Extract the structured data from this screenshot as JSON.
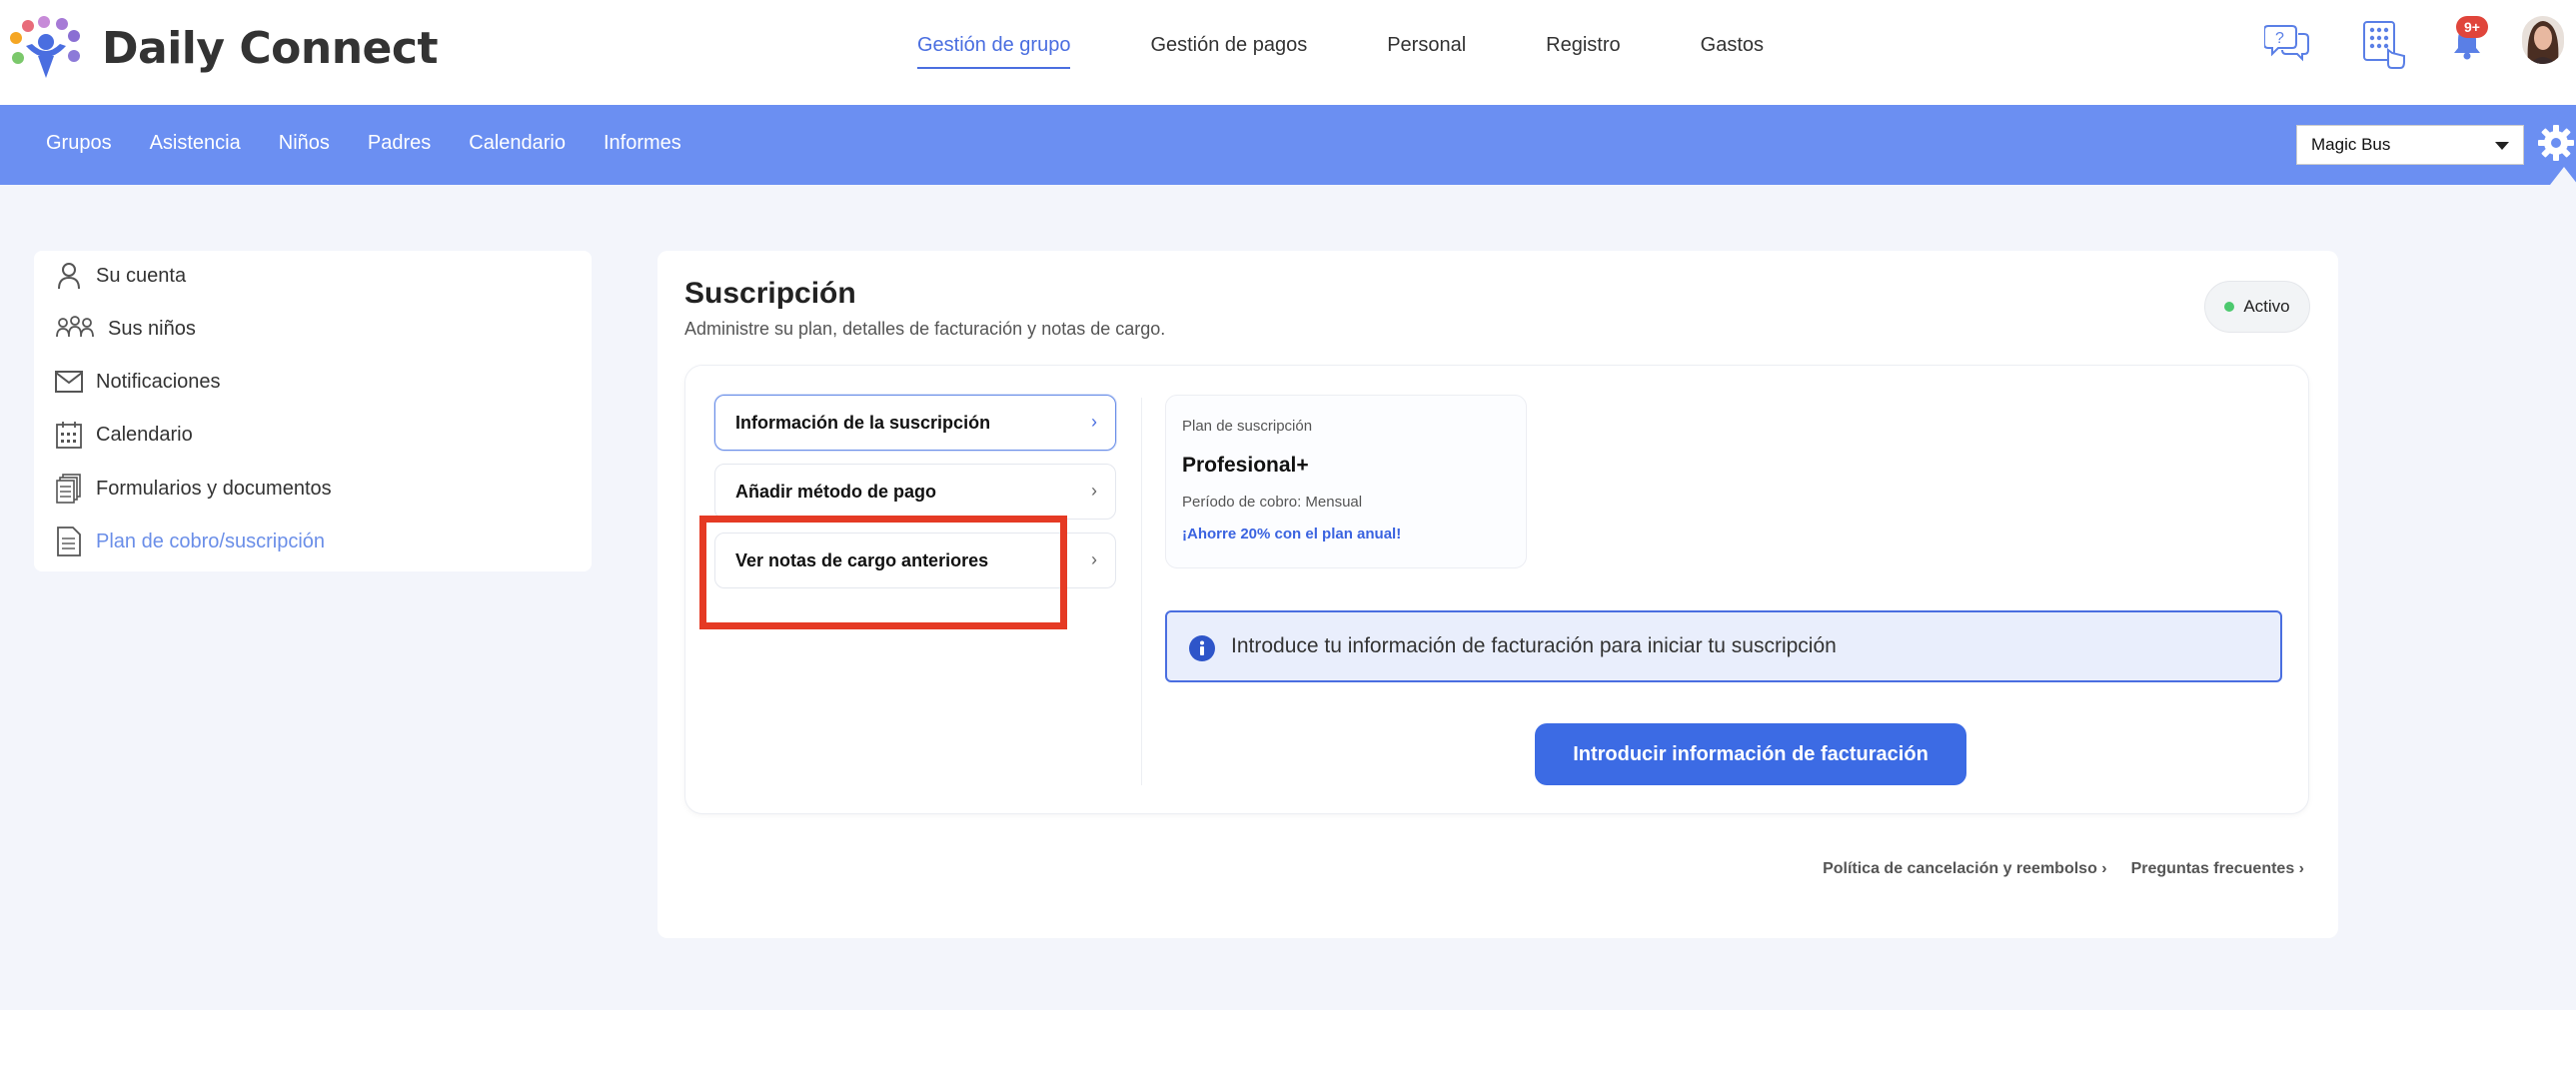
{
  "app": {
    "name": "Daily Connect"
  },
  "top_nav": [
    {
      "label": "Gestión de grupo",
      "active": true
    },
    {
      "label": "Gestión de pagos",
      "active": false
    },
    {
      "label": "Personal",
      "active": false
    },
    {
      "label": "Registro",
      "active": false
    },
    {
      "label": "Gastos",
      "active": false
    }
  ],
  "top_icons": {
    "help": "chat-help-icon",
    "keypad": "keypad-icon",
    "notifications": "bell-icon",
    "notification_badge": "9+"
  },
  "sub_nav": [
    {
      "label": "Grupos"
    },
    {
      "label": "Asistencia"
    },
    {
      "label": "Niños"
    },
    {
      "label": "Padres"
    },
    {
      "label": "Calendario"
    },
    {
      "label": "Informes"
    }
  ],
  "center_select": {
    "value": "Magic Bus"
  },
  "sidebar": {
    "items": [
      {
        "label": "Su cuenta",
        "icon": "user-icon",
        "active": false
      },
      {
        "label": "Sus niños",
        "icon": "children-icon",
        "active": false
      },
      {
        "label": "Notificaciones",
        "icon": "mail-icon",
        "active": false
      },
      {
        "label": "Calendario",
        "icon": "calendar-icon",
        "active": false
      },
      {
        "label": "Formularios y documentos",
        "icon": "documents-icon",
        "active": false
      },
      {
        "label": "Plan de cobro/suscripción",
        "icon": "document-icon",
        "active": true
      }
    ]
  },
  "main": {
    "title": "Suscripción",
    "subtitle": "Administre su plan, detalles de facturación y notas de cargo.",
    "status": "Activo",
    "menu": [
      {
        "label": "Información de la suscripción",
        "active": true
      },
      {
        "label": "Añadir método de pago",
        "active": false
      },
      {
        "label": "Ver notas de cargo anteriores",
        "active": false
      }
    ],
    "plan": {
      "label": "Plan de suscripción",
      "name": "Profesional+",
      "period": "Período de cobro:  Mensual",
      "savings": "¡Ahorre 20% con el plan anual!"
    },
    "info_message": "Introduce tu información de facturación para iniciar tu suscripción",
    "cta_label": "Introducir información de facturación",
    "footer_links": [
      {
        "label": "Política de cancelación y reembolso ›"
      },
      {
        "label": "Preguntas frecuentes ›"
      }
    ]
  },
  "colors": {
    "accent": "#4a6ee0",
    "subbar": "#6b8ff2",
    "cta": "#3c6be4",
    "highlight": "#e53a24",
    "status_dot": "#4cc96e"
  }
}
